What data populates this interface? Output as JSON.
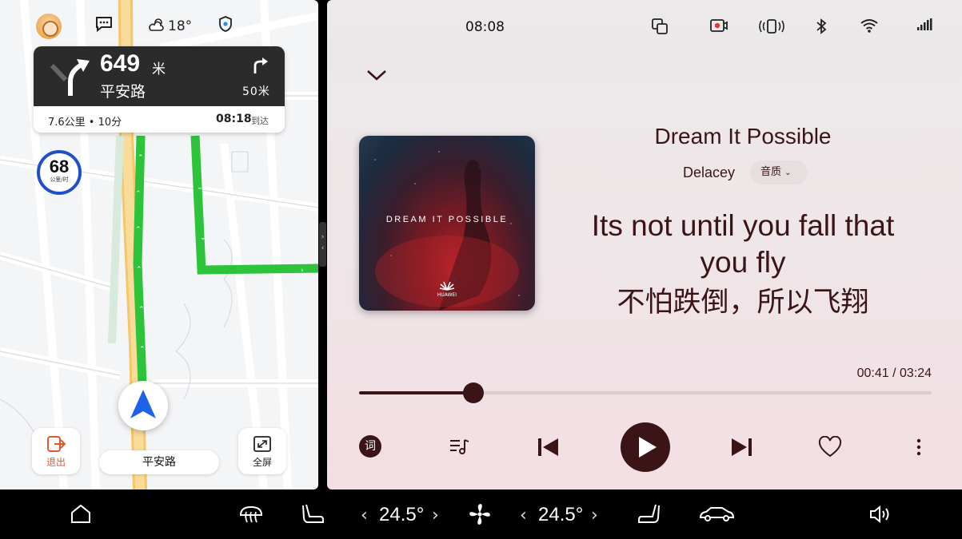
{
  "map": {
    "weather_temp": "18°",
    "distance_value": "649",
    "distance_unit": "米",
    "road_name": "平安路",
    "next_turn_distance": "50米",
    "trip_summary": "7.6公里 • 10分",
    "arrival_time": "08:18",
    "arrival_label": "到达",
    "speed_limit": "68",
    "speed_unit": "公里/时",
    "exit_label": "退出",
    "current_road": "平安路",
    "fullscreen_label": "全屏"
  },
  "status": {
    "time": "08:08"
  },
  "player": {
    "song_title": "Dream It Possible",
    "artist": "Delacey",
    "quality_label": "音质",
    "album_text": "DREAM IT POSSIBLE",
    "album_brand": "HUAWEI",
    "lyric_line1": "Its not until you fall that",
    "lyric_line2": "you fly",
    "lyric_line3": "不怕跌倒，所以飞翔",
    "time_display": "00:41 / 03:24",
    "progress": 0.2,
    "lyrics_button": "词"
  },
  "climate": {
    "left_temp": "24.5°",
    "right_temp": "24.5°"
  },
  "colors": {
    "route_green": "#2dc33a",
    "accent_dark": "#3a1417",
    "nav_blue": "#1e50c8"
  }
}
